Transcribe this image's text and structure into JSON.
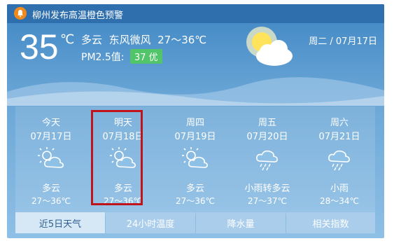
{
  "alert": {
    "icon": "bell-icon",
    "text": "柳州发布高温橙色预警"
  },
  "current": {
    "temp": "35",
    "unit": "℃",
    "condition": "多云",
    "wind": "东风微风",
    "range": "27～36℃",
    "pm_label": "PM2.5值:",
    "aqi": "37 优",
    "date": "周二 / 07月17日"
  },
  "forecast": [
    {
      "name": "今天",
      "date": "07月17日",
      "icon": "partly-cloudy-icon",
      "condition": "多云",
      "range": "27～36℃"
    },
    {
      "name": "明天",
      "date": "07月18日",
      "icon": "partly-cloudy-icon",
      "condition": "多云",
      "range": "27～36℃"
    },
    {
      "name": "周四",
      "date": "07月19日",
      "icon": "partly-cloudy-icon",
      "condition": "多云",
      "range": "27～36℃"
    },
    {
      "name": "周五",
      "date": "07月20日",
      "icon": "rain-cloud-icon",
      "condition": "小雨转多云",
      "range": "27～37℃"
    },
    {
      "name": "周六",
      "date": "07月21日",
      "icon": "rain-cloud-icon",
      "condition": "小雨",
      "range": "28～34℃"
    }
  ],
  "tabs": [
    "近5日天气",
    "24小时温度",
    "降水量",
    "相关指数"
  ],
  "colors": {
    "alert": "#f08a1c",
    "aqi_good": "#52c46a",
    "highlight": "#c0131b",
    "sky": "#3f86c4"
  }
}
